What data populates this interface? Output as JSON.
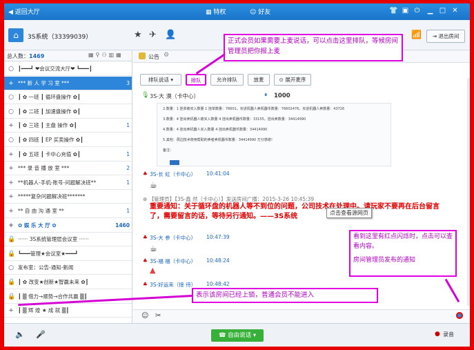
{
  "titlebar": {
    "back": "返回大厅",
    "privilege": "特权",
    "friends": "好友"
  },
  "room": {
    "name": "3S系统（33399039）",
    "exit_button": "退出房间"
  },
  "left": {
    "total_label": "总人数：",
    "total_count": "1469",
    "rows": [
      {
        "icon": "○",
        "text": "┃━━━┛ ❤会议交流大厅❤ ┗━━━┃",
        "count": ""
      },
      {
        "icon": "+",
        "text": "*** 新 人 学 习 室 ***",
        "count": "3",
        "highlight": true
      },
      {
        "icon": "○",
        "text": "┃ ✿ 一班 ┃ 循环盘操作 ✿┃",
        "count": ""
      },
      {
        "icon": "○",
        "text": "┃ ✿ 二班 ┃ 加速盘操作 ✿┃",
        "count": ""
      },
      {
        "icon": "+",
        "text": "┃ ✿ 三班 ┃ 主盘  操作 ✿┃",
        "count": "1"
      },
      {
        "icon": "○",
        "text": "┃ ✿ 四班 ┃ EP 买卖操作 ✿┃",
        "count": ""
      },
      {
        "icon": "+",
        "text": "┃ ✿ 五班 ┃ 卡中心充值 ✿┃",
        "count": "1"
      },
      {
        "icon": "+",
        "text": "*** 录 音 播 放 室 ***",
        "count": "2"
      },
      {
        "icon": "+",
        "text": "**机器人-手机-账号-问题解决班**",
        "count": "1"
      },
      {
        "icon": "+",
        "text": "*****复杂问题解决班*******",
        "count": ""
      },
      {
        "icon": "+",
        "text": "** 自 由 沟 通 室 **",
        "count": "1"
      },
      {
        "icon": "+",
        "text": "✿ 娱 乐 大 厅 ✿",
        "count": "1460",
        "bold": true
      },
      {
        "icon": "🔒",
        "text": "······ 3S系统管理层会议室 ······",
        "count": ""
      },
      {
        "icon": "🔒",
        "text": "┗━━━管理★会议室★━━━┛",
        "count": ""
      },
      {
        "icon": "○",
        "text": "发布室：公告-通知-新闻",
        "count": ""
      },
      {
        "icon": "🔒",
        "text": "┃ ✿ 改变★创新★智赢未来 ✿┃",
        "count": ""
      },
      {
        "icon": "🔒",
        "text": "┃ ▒ 借力→顺势→合作共赢 ▒┃",
        "count": ""
      },
      {
        "icon": "+",
        "text": "┃ ▒ 辉 煌 ★ 成 就 ▒┃",
        "count": ""
      }
    ]
  },
  "main": {
    "announcement": "公告",
    "queue_select": "排队说话",
    "buttons": {
      "queue": "排队",
      "allow_queue": "允许排队",
      "release": "放麦",
      "expand_mic": "展开麦序"
    },
    "speaker": "3S-大 漠（卡中心）",
    "speaker_count": "1000",
    "doc_lines": [
      "2.数量：1 挂单被买入数量 1 挂单数量：76601，买进机器人卖机器币数量：76602476，买进机器人卖数量：43726",
      "3.数量：4 挂出卖机器人被买入数量 4 挂出卖机器币数量：33155，挂出卖数量：34414990",
      "4.数量：4 挂出卖机器人买入数量 4 挂出卖机器币数量：34414990",
      "5.其他：周边技术使用帮助的卖者卖机器币数量：34414990  万分感谢！",
      "备注："
    ],
    "messages": [
      {
        "name": "3S-长  虹（卡中心）",
        "time": "10:41:04"
      },
      {
        "name": "3S-大  参（卡中心）",
        "time": "10:47:39"
      },
      {
        "name": "3S-福  福（卡中心）",
        "time": "10:48:24"
      },
      {
        "name": "3S-好运来（接  待）",
        "time": "10:48:42"
      }
    ],
    "broadcast": {
      "header": "【管理员】【3S-鑫  然（卡中心）】发送房间广播：2015-3-26 10:45:39",
      "text": "重要通知：关于循环盘的机器人等不到位的问题，公司技术在处理中。请玩家不要再在后台留言了，需要留言的话，等待另行通知。——3S系统",
      "tooltip": "点击查看源网页"
    }
  },
  "bottom": {
    "free_speak": "自由说话",
    "record": "录音"
  },
  "annotations": {
    "top": "正式会员如果需要上麦说话，可以点击这里排队，等候房间管理员把你报上麦",
    "right1": "看到这里有红点闪烁时，点击可以查看内容。",
    "right2": "房间管理员发布的通知",
    "bottom": "表示该房间已经上锁，普通会员不能进入"
  },
  "colors": {
    "titlebar": "#1a74c9",
    "callout": "#e000e0",
    "alert": "#e00000",
    "highlight_row": "#2d86d9"
  }
}
